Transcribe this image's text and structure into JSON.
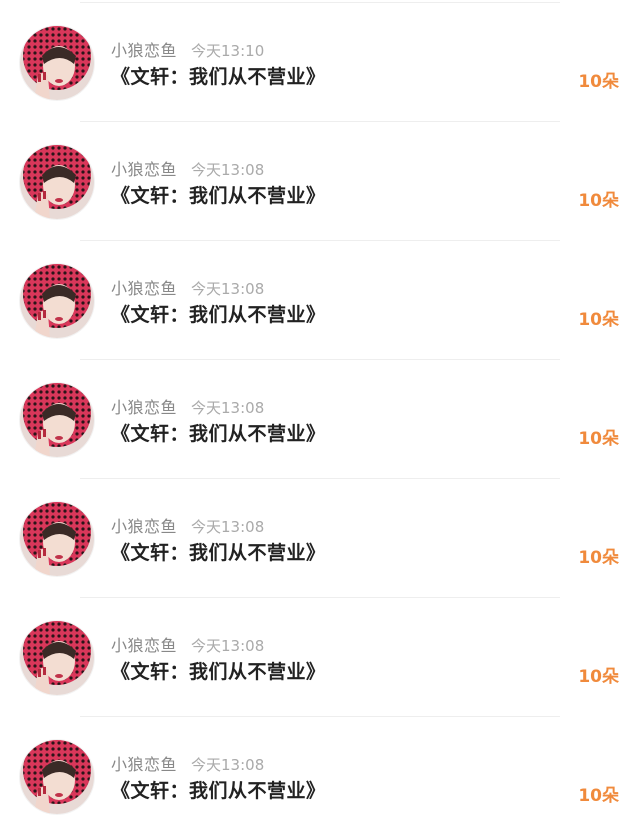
{
  "accent_color": "#f08a3c",
  "rows": [
    {
      "avatar_icon": "user-avatar-photo",
      "username": "小狼恋鱼",
      "time": "今天13:10",
      "title": "《文轩：我们从不营业》",
      "count": "10朵"
    },
    {
      "avatar_icon": "user-avatar-photo",
      "username": "小狼恋鱼",
      "time": "今天13:08",
      "title": "《文轩：我们从不营业》",
      "count": "10朵"
    },
    {
      "avatar_icon": "user-avatar-photo",
      "username": "小狼恋鱼",
      "time": "今天13:08",
      "title": "《文轩：我们从不营业》",
      "count": "10朵"
    },
    {
      "avatar_icon": "user-avatar-photo",
      "username": "小狼恋鱼",
      "time": "今天13:08",
      "title": "《文轩：我们从不营业》",
      "count": "10朵"
    },
    {
      "avatar_icon": "user-avatar-photo",
      "username": "小狼恋鱼",
      "time": "今天13:08",
      "title": "《文轩：我们从不营业》",
      "count": "10朵"
    },
    {
      "avatar_icon": "user-avatar-photo",
      "username": "小狼恋鱼",
      "time": "今天13:08",
      "title": "《文轩：我们从不营业》",
      "count": "10朵"
    },
    {
      "avatar_icon": "user-avatar-photo",
      "username": "小狼恋鱼",
      "time": "今天13:08",
      "title": "《文轩：我们从不营业》",
      "count": "10朵"
    }
  ]
}
